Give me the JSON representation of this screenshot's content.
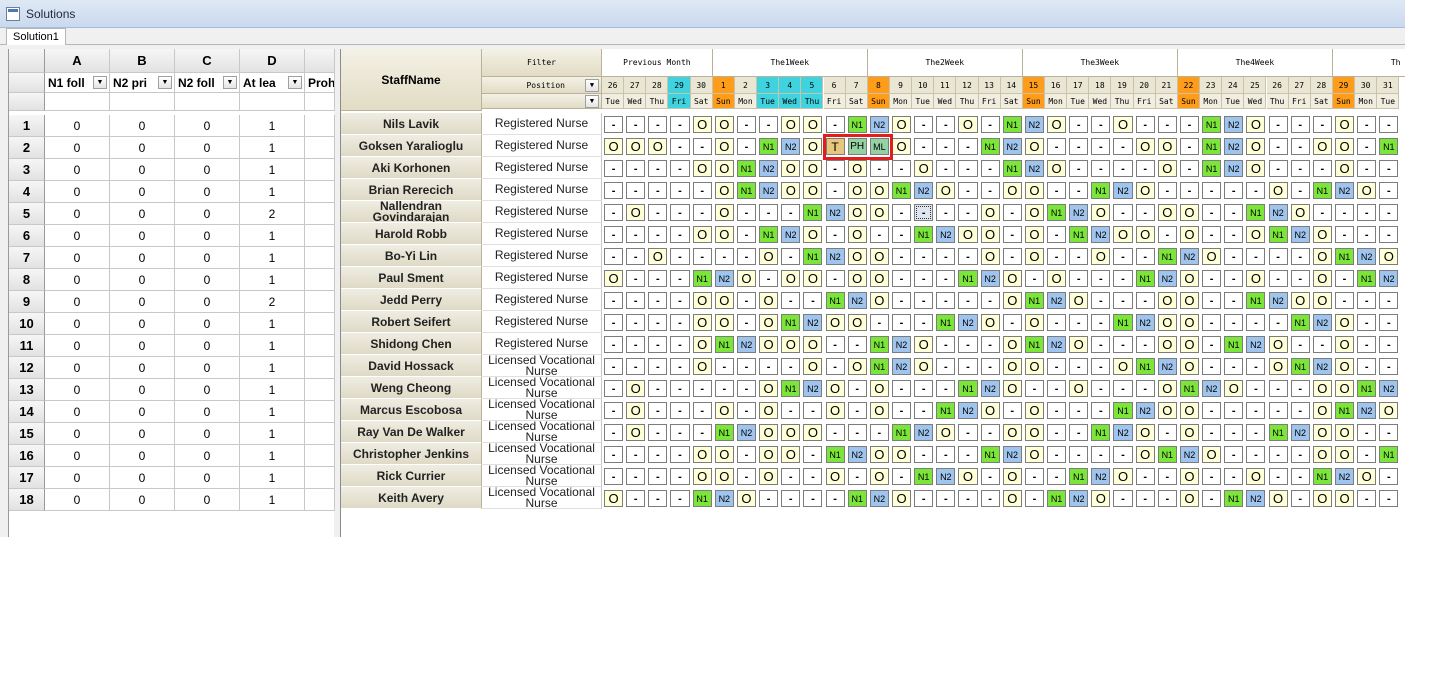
{
  "window": {
    "title": "Solutions"
  },
  "tabs": [
    {
      "label": "Solution1"
    }
  ],
  "left_grid": {
    "columns": [
      {
        "letter": "A",
        "filter": "N1 foll"
      },
      {
        "letter": "B",
        "filter": "N2 pri"
      },
      {
        "letter": "C",
        "filter": "N2 foll"
      },
      {
        "letter": "D",
        "filter": "At lea"
      },
      {
        "letter": "",
        "filter": "Proh"
      }
    ],
    "rows": [
      [
        "1",
        "0",
        "0",
        "0",
        "1"
      ],
      [
        "2",
        "0",
        "0",
        "0",
        "1"
      ],
      [
        "3",
        "0",
        "0",
        "0",
        "1"
      ],
      [
        "4",
        "0",
        "0",
        "0",
        "1"
      ],
      [
        "5",
        "0",
        "0",
        "0",
        "2"
      ],
      [
        "6",
        "0",
        "0",
        "0",
        "1"
      ],
      [
        "7",
        "0",
        "0",
        "0",
        "1"
      ],
      [
        "8",
        "0",
        "0",
        "0",
        "1"
      ],
      [
        "9",
        "0",
        "0",
        "0",
        "2"
      ],
      [
        "10",
        "0",
        "0",
        "0",
        "1"
      ],
      [
        "11",
        "0",
        "0",
        "0",
        "1"
      ],
      [
        "12",
        "0",
        "0",
        "0",
        "1"
      ],
      [
        "13",
        "0",
        "0",
        "0",
        "1"
      ],
      [
        "14",
        "0",
        "0",
        "0",
        "1"
      ],
      [
        "15",
        "0",
        "0",
        "0",
        "1"
      ],
      [
        "16",
        "0",
        "0",
        "0",
        "1"
      ],
      [
        "17",
        "0",
        "0",
        "0",
        "1"
      ],
      [
        "18",
        "0",
        "0",
        "0",
        "1"
      ]
    ]
  },
  "roster": {
    "staff_header": "StaffName",
    "filter_header": "Filter",
    "position_header": "Position",
    "weeks": [
      "Previous Month",
      "The1Week",
      "The2Week",
      "The3Week",
      "The4Week",
      "Th"
    ],
    "day_numbers": [
      "26",
      "27",
      "28",
      "29",
      "30",
      "1",
      "2",
      "3",
      "4",
      "5",
      "6",
      "7",
      "8",
      "9",
      "10",
      "11",
      "12",
      "13",
      "14",
      "15",
      "16",
      "17",
      "18",
      "19",
      "20",
      "21",
      "22",
      "23",
      "24",
      "25",
      "26",
      "27",
      "28",
      "29",
      "30",
      "31"
    ],
    "weekdays": [
      "Tue",
      "Wed",
      "Thu",
      "Fri",
      "Sat",
      "Sun",
      "Mon",
      "Tue",
      "Wed",
      "Thu",
      "Fri",
      "Sat",
      "Sun",
      "Mon",
      "Tue",
      "Wed",
      "Thu",
      "Fri",
      "Sat",
      "Sun",
      "Mon",
      "Tue",
      "Wed",
      "Thu",
      "Fri",
      "Sat",
      "Sun",
      "Mon",
      "Tue",
      "Wed",
      "Thu",
      "Fri",
      "Sat",
      "Sun",
      "Mon",
      "Tue"
    ],
    "day_colors": [
      "#e9e6d4",
      "#e9e6d4",
      "#e9e6d4",
      "#3fd3e0",
      "#e9e6d4",
      "#ff9c1a",
      "#e9e6d4",
      "#3fd3e0",
      "#3fd3e0",
      "#3fd3e0",
      "#e9e6d4",
      "#e9e6d4",
      "#ff9c1a",
      "#e9e6d4",
      "#e9e6d4",
      "#e9e6d4",
      "#e9e6d4",
      "#e9e6d4",
      "#e9e6d4",
      "#ff9c1a",
      "#e9e6d4",
      "#e9e6d4",
      "#e9e6d4",
      "#e9e6d4",
      "#e9e6d4",
      "#e9e6d4",
      "#ff9c1a",
      "#e9e6d4",
      "#e9e6d4",
      "#e9e6d4",
      "#e9e6d4",
      "#e9e6d4",
      "#e9e6d4",
      "#ff9c1a",
      "#e9e6d4",
      "#e9e6d4"
    ],
    "staff": [
      {
        "name": "Nils Lavik",
        "position": "Registered Nurse",
        "shifts": [
          "-",
          "-",
          "-",
          "-",
          "O",
          "O",
          "-",
          "-",
          "O",
          "O",
          "-",
          "N1",
          "N2",
          "O",
          "-",
          "-",
          "O",
          "-",
          "N1",
          "N2",
          "O",
          "-",
          "-",
          "O",
          "-",
          "-",
          "-",
          "N1",
          "N2",
          "O",
          "-",
          "-",
          "-",
          "O",
          "-",
          "-"
        ]
      },
      {
        "name": "Goksen Yaralioglu",
        "position": "Registered Nurse",
        "shifts": [
          "O",
          "O",
          "O",
          "-",
          "-",
          "O",
          "-",
          "N1",
          "N2",
          "O",
          "T",
          "PH",
          "ML",
          "O",
          "-",
          "-",
          "-",
          "N1",
          "N2",
          "O",
          "-",
          "-",
          "-",
          "-",
          "O",
          "O",
          "-",
          "N1",
          "N2",
          "O",
          "-",
          "-",
          "O",
          "O",
          "-",
          "N1"
        ]
      },
      {
        "name": "Aki Korhonen",
        "position": "Registered Nurse",
        "shifts": [
          "-",
          "-",
          "-",
          "-",
          "O",
          "O",
          "N1",
          "N2",
          "O",
          "O",
          "-",
          "O",
          "-",
          "-",
          "O",
          "-",
          "-",
          "-",
          "N1",
          "N2",
          "O",
          "-",
          "-",
          "-",
          "-",
          "O",
          "-",
          "N1",
          "N2",
          "O",
          "-",
          "-",
          "-",
          "O",
          "-",
          "-"
        ]
      },
      {
        "name": "Brian Rerecich",
        "position": "Registered Nurse",
        "shifts": [
          "-",
          "-",
          "-",
          "-",
          "-",
          "O",
          "N1",
          "N2",
          "O",
          "O",
          "-",
          "O",
          "O",
          "N1",
          "N2",
          "O",
          "-",
          "-",
          "O",
          "O",
          "-",
          "-",
          "N1",
          "N2",
          "O",
          "-",
          "-",
          "-",
          "-",
          "-",
          "O",
          "-",
          "N1",
          "N2",
          "O",
          "-"
        ]
      },
      {
        "name": "Nallendran Govindarajan",
        "position": "Registered Nurse",
        "shifts": [
          "-",
          "O",
          "-",
          "-",
          "-",
          "O",
          "-",
          "-",
          "-",
          "N1",
          "N2",
          "O",
          "O",
          "-",
          "-",
          "-",
          "-",
          "O",
          "-",
          "O",
          "N1",
          "N2",
          "O",
          "-",
          "-",
          "O",
          "O",
          "-",
          "-",
          "N1",
          "N2",
          "O",
          "-",
          "-",
          "-",
          "-"
        ]
      },
      {
        "name": "Harold Robb",
        "position": "Registered Nurse",
        "shifts": [
          "-",
          "-",
          "-",
          "-",
          "O",
          "O",
          "-",
          "N1",
          "N2",
          "O",
          "-",
          "O",
          "-",
          "-",
          "N1",
          "N2",
          "O",
          "O",
          "-",
          "O",
          "-",
          "N1",
          "N2",
          "O",
          "O",
          "-",
          "O",
          "-",
          "-",
          "O",
          "N1",
          "N2",
          "O",
          "-",
          "-",
          "-"
        ]
      },
      {
        "name": "Bo-Yi Lin",
        "position": "Registered Nurse",
        "shifts": [
          "-",
          "-",
          "O",
          "-",
          "-",
          "-",
          "-",
          "O",
          "-",
          "N1",
          "N2",
          "O",
          "O",
          "-",
          "-",
          "-",
          "-",
          "O",
          "-",
          "O",
          "-",
          "-",
          "O",
          "-",
          "-",
          "N1",
          "N2",
          "O",
          "-",
          "-",
          "-",
          "-",
          "O",
          "N1",
          "N2",
          "O"
        ]
      },
      {
        "name": "Paul Sment",
        "position": "Registered Nurse",
        "shifts": [
          "O",
          "-",
          "-",
          "-",
          "N1",
          "N2",
          "O",
          "-",
          "O",
          "O",
          "-",
          "O",
          "O",
          "-",
          "-",
          "-",
          "N1",
          "N2",
          "O",
          "-",
          "O",
          "-",
          "-",
          "-",
          "N1",
          "N2",
          "O",
          "-",
          "-",
          "O",
          "-",
          "-",
          "O",
          "-",
          "N1",
          "N2"
        ]
      },
      {
        "name": "Jedd Perry",
        "position": "Registered Nurse",
        "shifts": [
          "-",
          "-",
          "-",
          "-",
          "O",
          "O",
          "-",
          "O",
          "-",
          "-",
          "N1",
          "N2",
          "O",
          "-",
          "-",
          "-",
          "-",
          "-",
          "O",
          "N1",
          "N2",
          "O",
          "-",
          "-",
          "-",
          "O",
          "O",
          "-",
          "-",
          "N1",
          "N2",
          "O",
          "O",
          "-",
          "-",
          "-"
        ]
      },
      {
        "name": "Robert Seifert",
        "position": "Registered Nurse",
        "shifts": [
          "-",
          "-",
          "-",
          "-",
          "O",
          "O",
          "-",
          "O",
          "N1",
          "N2",
          "O",
          "O",
          "-",
          "-",
          "-",
          "N1",
          "N2",
          "O",
          "-",
          "O",
          "-",
          "-",
          "-",
          "N1",
          "N2",
          "O",
          "O",
          "-",
          "-",
          "-",
          "-",
          "N1",
          "N2",
          "O",
          "-",
          "-"
        ]
      },
      {
        "name": "Shidong Chen",
        "position": "Registered Nurse",
        "shifts": [
          "-",
          "-",
          "-",
          "-",
          "O",
          "N1",
          "N2",
          "O",
          "O",
          "O",
          "-",
          "-",
          "N1",
          "N2",
          "O",
          "-",
          "-",
          "-",
          "O",
          "N1",
          "N2",
          "O",
          "-",
          "-",
          "-",
          "O",
          "O",
          "-",
          "N1",
          "N2",
          "O",
          "-",
          "-",
          "O",
          "-",
          "-"
        ]
      },
      {
        "name": "David Hossack",
        "position": "Licensed Vocational Nurse",
        "shifts": [
          "-",
          "-",
          "-",
          "-",
          "O",
          "-",
          "-",
          "-",
          "-",
          "O",
          "-",
          "O",
          "N1",
          "N2",
          "O",
          "-",
          "-",
          "-",
          "O",
          "O",
          "-",
          "-",
          "-",
          "O",
          "N1",
          "N2",
          "O",
          "-",
          "-",
          "-",
          "O",
          "N1",
          "N2",
          "O",
          "-",
          "-"
        ]
      },
      {
        "name": "Weng Cheong",
        "position": "Licensed Vocational Nurse",
        "shifts": [
          "-",
          "O",
          "-",
          "-",
          "-",
          "-",
          "-",
          "O",
          "N1",
          "N2",
          "O",
          "-",
          "O",
          "-",
          "-",
          "-",
          "N1",
          "N2",
          "O",
          "-",
          "-",
          "O",
          "-",
          "-",
          "-",
          "O",
          "N1",
          "N2",
          "O",
          "-",
          "-",
          "-",
          "O",
          "O",
          "N1",
          "N2"
        ]
      },
      {
        "name": "Marcus Escobosa",
        "position": "Licensed Vocational Nurse",
        "shifts": [
          "-",
          "O",
          "-",
          "-",
          "-",
          "O",
          "-",
          "O",
          "-",
          "-",
          "O",
          "-",
          "O",
          "-",
          "-",
          "N1",
          "N2",
          "O",
          "-",
          "O",
          "-",
          "-",
          "-",
          "N1",
          "N2",
          "O",
          "O",
          "-",
          "-",
          "-",
          "-",
          "-",
          "O",
          "N1",
          "N2",
          "O"
        ]
      },
      {
        "name": "Ray Van De Walker",
        "position": "Licensed Vocational Nurse",
        "shifts": [
          "-",
          "O",
          "-",
          "-",
          "-",
          "N1",
          "N2",
          "O",
          "O",
          "O",
          "-",
          "-",
          "-",
          "N1",
          "N2",
          "O",
          "-",
          "-",
          "O",
          "O",
          "-",
          "-",
          "N1",
          "N2",
          "O",
          "-",
          "O",
          "-",
          "-",
          "-",
          "N1",
          "N2",
          "O",
          "O",
          "-",
          "-"
        ]
      },
      {
        "name": "Christopher Jenkins",
        "position": "Licensed Vocational Nurse",
        "shifts": [
          "-",
          "-",
          "-",
          "-",
          "O",
          "O",
          "-",
          "O",
          "O",
          "-",
          "N1",
          "N2",
          "O",
          "O",
          "-",
          "-",
          "-",
          "N1",
          "N2",
          "O",
          "-",
          "-",
          "-",
          "-",
          "O",
          "N1",
          "N2",
          "O",
          "-",
          "-",
          "-",
          "-",
          "O",
          "O",
          "-",
          "N1"
        ]
      },
      {
        "name": "Rick Currier",
        "position": "Licensed Vocational Nurse",
        "shifts": [
          "-",
          "-",
          "-",
          "-",
          "O",
          "O",
          "-",
          "O",
          "-",
          "-",
          "O",
          "-",
          "O",
          "-",
          "N1",
          "N2",
          "O",
          "-",
          "O",
          "-",
          "-",
          "N1",
          "N2",
          "O",
          "-",
          "-",
          "O",
          "-",
          "-",
          "O",
          "-",
          "-",
          "N1",
          "N2",
          "O",
          "-"
        ]
      },
      {
        "name": "Keith Avery",
        "position": "Licensed Vocational Nurse",
        "shifts": [
          "O",
          "-",
          "-",
          "-",
          "N1",
          "N2",
          "O",
          "-",
          "-",
          "-",
          "-",
          "N1",
          "N2",
          "O",
          "-",
          "-",
          "-",
          "-",
          "O",
          "-",
          "N1",
          "N2",
          "O",
          "-",
          "-",
          "-",
          "O",
          "-",
          "N1",
          "N2",
          "O",
          "-",
          "O",
          "O",
          "-",
          "-"
        ]
      }
    ],
    "selected": {
      "row": 4,
      "col": 14
    },
    "highlight": {
      "row": 1,
      "from_col": 10,
      "to_col": 12
    }
  },
  "colors": {
    "O": "#ffffd8",
    "N1": "#7be53a",
    "N2": "#9fc4ee",
    "T": "#e6c77d",
    "PH": "#94d1a3",
    "ML": "#94d1a3",
    "highlight": "#e01e1e"
  }
}
